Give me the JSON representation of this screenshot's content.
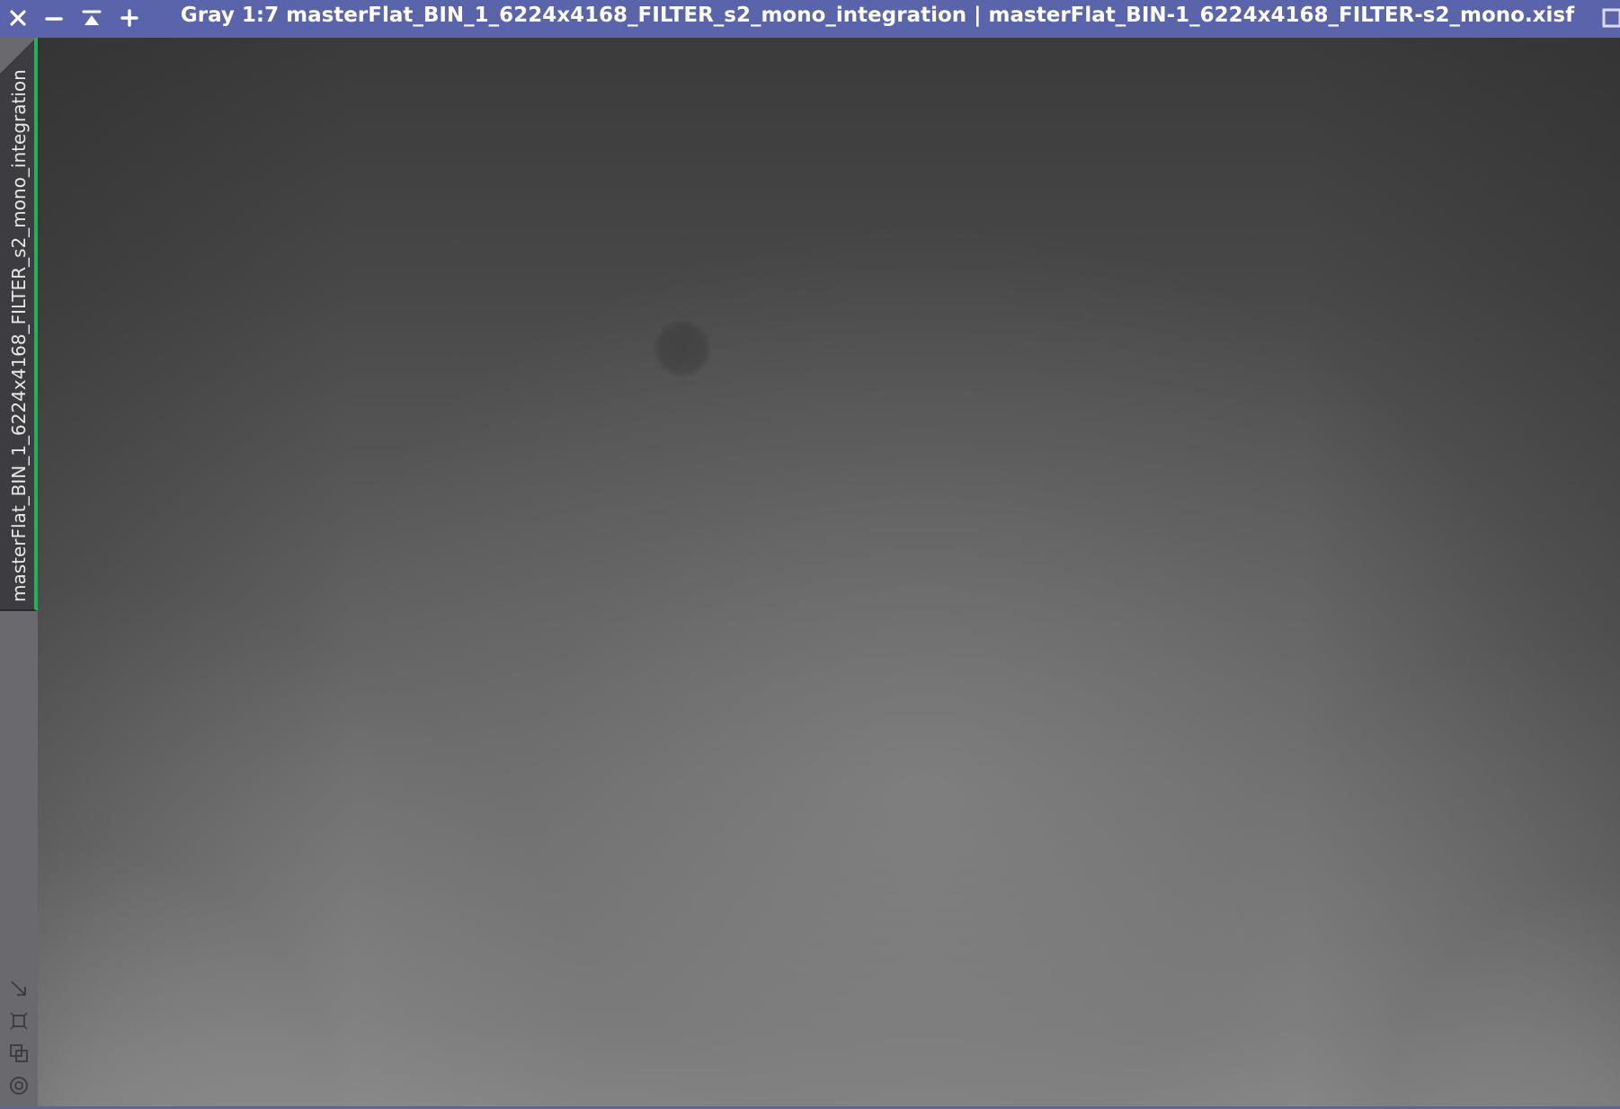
{
  "window": {
    "title": "Gray 1:7 masterFlat_BIN_1_6224x4168_FILTER_s2_mono_integration | masterFlat_BIN-1_6224x4168_FILTER-s2_mono.xisf",
    "titlebar_color": "#5a64aa",
    "buttons": {
      "close": "close-icon",
      "minimize": "minimize-icon",
      "shade": "shade-icon",
      "maximize": "plus-icon"
    }
  },
  "view_tab": {
    "label": "masterFlat_BIN_1_6224x4168_FILTER_s2_mono_integration",
    "active_color": "#1fb25a"
  },
  "side_icons": [
    "resize-arrow-icon",
    "fit-view-icon",
    "clone-view-icon",
    "target-icon"
  ]
}
